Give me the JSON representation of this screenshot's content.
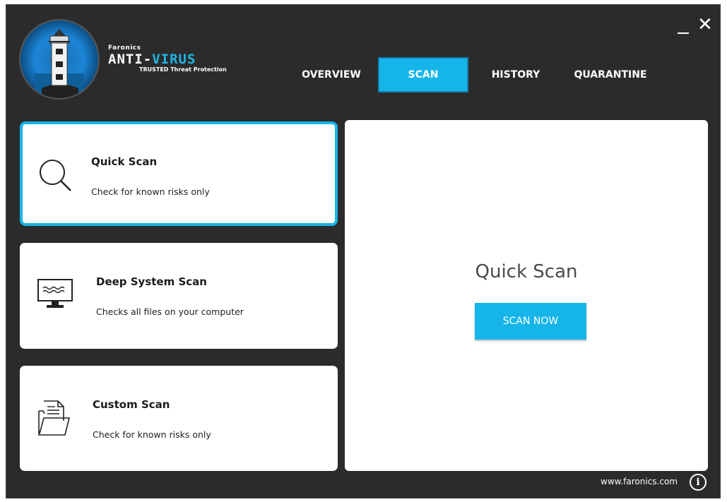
{
  "brand": {
    "company": "Faronics",
    "product_part1": "ANTI-",
    "product_part2": "VIRUS",
    "tagline": "TRUSTED Threat Protection",
    "logo_icon": "lighthouse-icon"
  },
  "window": {
    "minimize_icon": "minimize-icon",
    "close_icon": "close-icon",
    "close_glyph": "✕"
  },
  "tabs": [
    {
      "label": "OVERVIEW",
      "active": false
    },
    {
      "label": "SCAN",
      "active": true
    },
    {
      "label": "HISTORY",
      "active": false
    },
    {
      "label": "QUARANTINE",
      "active": false
    }
  ],
  "scan_options": [
    {
      "title": "Quick Scan",
      "description": "Check for known risks only",
      "icon": "magnifier-icon",
      "selected": true
    },
    {
      "title": "Deep System Scan",
      "description": "Checks all files on your computer",
      "icon": "monitor-icon",
      "selected": false
    },
    {
      "title": "Custom Scan",
      "description": "Check for known risks only",
      "icon": "folder-document-icon",
      "selected": false
    }
  ],
  "panel": {
    "title": "Quick Scan",
    "button_label": "SCAN NOW"
  },
  "footer": {
    "link": "www.faronics.com",
    "info_icon": "info-icon",
    "info_glyph": "i"
  },
  "colors": {
    "accent": "#15b5ea",
    "background": "#2b2b2b",
    "panel": "#ffffff"
  }
}
